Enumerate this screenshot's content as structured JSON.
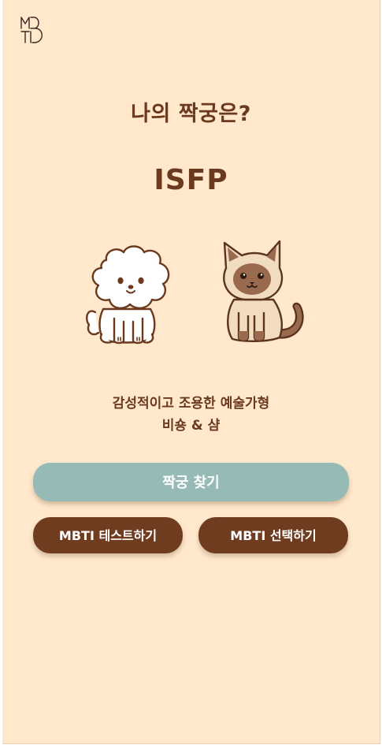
{
  "header": {
    "logo_lines": [
      "M",
      "D",
      "T",
      "I"
    ]
  },
  "main": {
    "title": "나의 짝궁은?",
    "mbti_type": "ISFP",
    "description_line1": "감성적이고 조용한 예술가형",
    "description_line2": "비숑 & 샴"
  },
  "buttons": {
    "find_partner": "짝궁 찾기",
    "mbti_test": "MBTI 테스트하기",
    "mbti_select": "MBTI 선택하기"
  },
  "colors": {
    "background": "#FFE8CC",
    "text_brown": "#6B3A1E",
    "primary_button": "#96BAB5",
    "secondary_button": "#703C20",
    "button_text": "#FFFFFF"
  },
  "icons": {
    "logo": "mbti-logo-icon",
    "dog": "bichon-dog-illustration",
    "cat": "siamese-cat-illustration"
  }
}
